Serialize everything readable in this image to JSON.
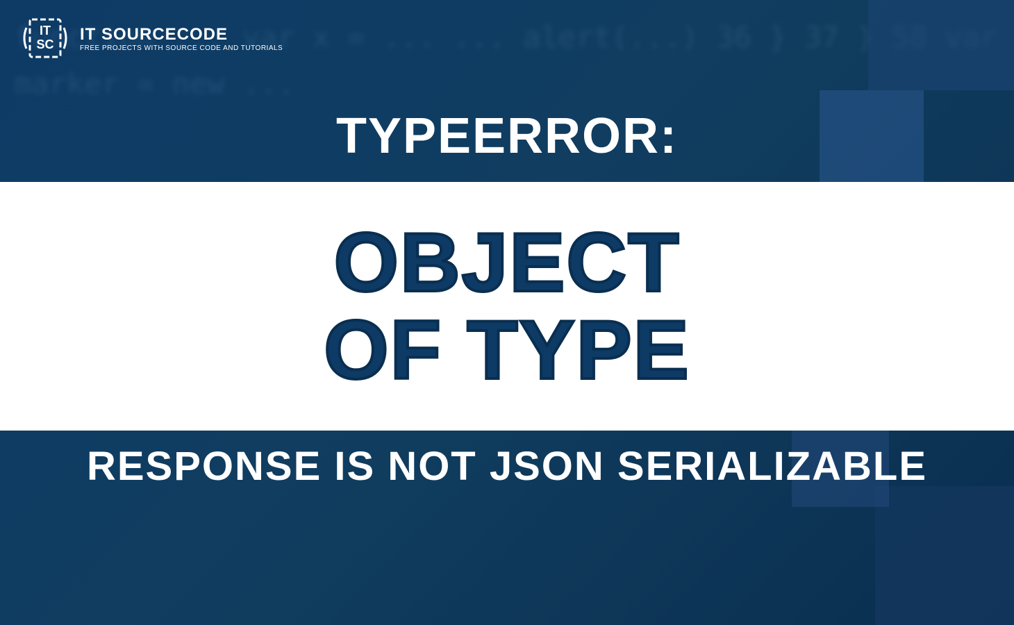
{
  "logo": {
    "title": "IT SOURCECODE",
    "tagline": "FREE PROJECTS WITH SOURCE CODE AND TUTORIALS"
  },
  "header": {
    "top": "TYPEERROR:",
    "middle_line1": "OBJECT",
    "middle_line2": "OF TYPE",
    "bottom": "RESPONSE IS NOT JSON SERIALIZABLE"
  },
  "bg_code_hint": "function ...\nvar x = ...\n...\nalert(...)\n36  }\n37 }\n58  var marker = new ..."
}
